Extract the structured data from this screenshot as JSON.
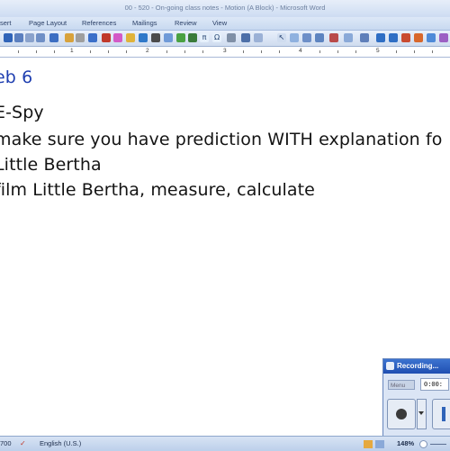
{
  "window": {
    "title": "00 - 520 - On-going class notes - Motion (A Block) - Microsoft Word"
  },
  "ribbon": {
    "tabs": [
      "sert",
      "Page Layout",
      "References",
      "Mailings",
      "Review",
      "View"
    ]
  },
  "ruler": {
    "marks": [
      "1",
      "2",
      "3",
      "4",
      "5"
    ]
  },
  "document": {
    "lines": [
      "eb 6",
      "E-Spy",
      "make sure you have prediction WITH explanation fo",
      "Little Bertha",
      "film Little Bertha, measure, calculate"
    ],
    "colors": {
      "heading": "#1f3fb0",
      "body": "#141414"
    }
  },
  "statusbar": {
    "words": "700",
    "language": "English (U.S.)",
    "zoom": "148%"
  },
  "recorder": {
    "title": "Recording...",
    "menu_label": "Menu",
    "time": "0:00:"
  }
}
